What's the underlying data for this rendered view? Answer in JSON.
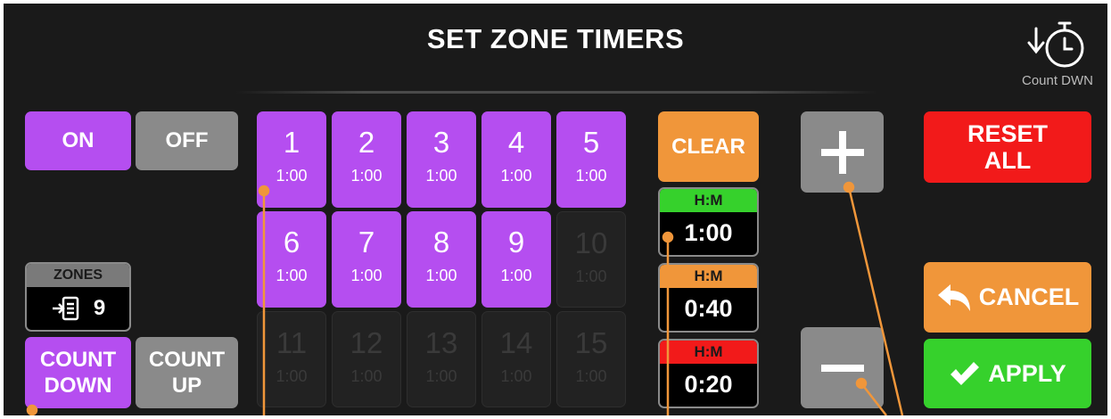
{
  "header": {
    "title": "SET ZONE TIMERS",
    "mode_label": "Count DWN"
  },
  "toggle": {
    "on_label": "ON",
    "off_label": "OFF"
  },
  "zones_counter": {
    "label": "ZONES",
    "value": "9"
  },
  "direction": {
    "count_down_line1": "COUNT",
    "count_down_line2": "DOWN",
    "count_up_line1": "COUNT",
    "count_up_line2": "UP"
  },
  "zones": [
    {
      "num": "1",
      "dur": "1:00"
    },
    {
      "num": "2",
      "dur": "1:00"
    },
    {
      "num": "3",
      "dur": "1:00"
    },
    {
      "num": "4",
      "dur": "1:00"
    },
    {
      "num": "5",
      "dur": "1:00"
    },
    {
      "num": "6",
      "dur": "1:00"
    },
    {
      "num": "7",
      "dur": "1:00"
    },
    {
      "num": "8",
      "dur": "1:00"
    },
    {
      "num": "9",
      "dur": "1:00"
    },
    {
      "num": "10",
      "dur": "1:00"
    },
    {
      "num": "11",
      "dur": "1:00"
    },
    {
      "num": "12",
      "dur": "1:00"
    },
    {
      "num": "13",
      "dur": "1:00"
    },
    {
      "num": "14",
      "dur": "1:00"
    },
    {
      "num": "15",
      "dur": "1:00"
    }
  ],
  "zone_states": [
    "on",
    "on",
    "on",
    "on",
    "on",
    "on",
    "on",
    "on",
    "on",
    "off",
    "off",
    "off",
    "off",
    "off",
    "off"
  ],
  "clear_label": "CLEAR",
  "timers": [
    {
      "header": "H:M",
      "value": "1:00",
      "color": "#36d12c"
    },
    {
      "header": "H:M",
      "value": "0:40",
      "color": "#f0963a"
    },
    {
      "header": "H:M",
      "value": "0:20",
      "color": "#f21a1a"
    }
  ],
  "adjust": {
    "plus_icon": "plus-icon",
    "minus_icon": "minus-icon"
  },
  "actions": {
    "reset_line1": "RESET",
    "reset_line2": "ALL",
    "cancel_label": "CANCEL",
    "apply_label": "APPLY"
  },
  "colors": {
    "purple": "#b54ef0",
    "grey": "#8a8a8a",
    "orange": "#f0963a",
    "red": "#f21a1a",
    "green": "#36d12c",
    "pointer": "#f0963a"
  }
}
